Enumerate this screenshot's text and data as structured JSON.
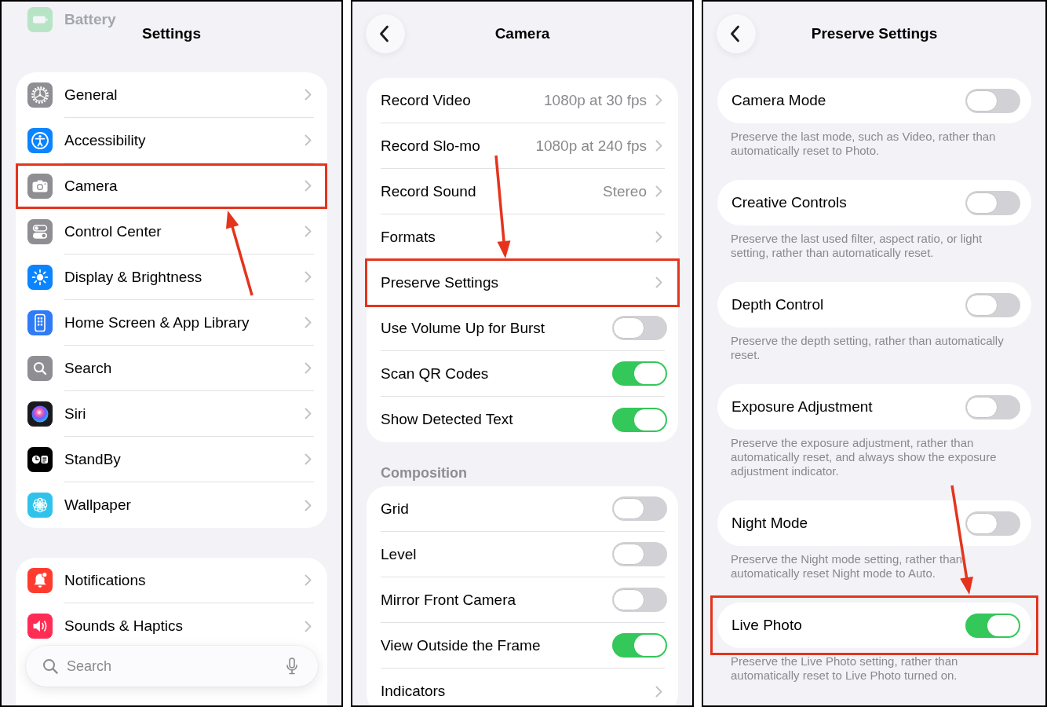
{
  "screens": [
    {
      "title": "Settings",
      "faded_item": {
        "label": "Battery"
      },
      "sections": [
        {
          "items": [
            {
              "kind": "app_link",
              "label": "General",
              "highlighted": false
            },
            {
              "kind": "app_link",
              "label": "Accessibility",
              "highlighted": false
            },
            {
              "kind": "app_link",
              "label": "Camera",
              "highlighted": true
            },
            {
              "kind": "app_link",
              "label": "Control Center",
              "highlighted": false
            },
            {
              "kind": "app_link",
              "label": "Display & Brightness",
              "highlighted": false
            },
            {
              "kind": "app_link",
              "label": "Home Screen & App Library",
              "highlighted": false
            },
            {
              "kind": "app_link",
              "label": "Search",
              "highlighted": false
            },
            {
              "kind": "app_link",
              "label": "Siri",
              "highlighted": false
            },
            {
              "kind": "app_link",
              "label": "StandBy",
              "highlighted": false
            },
            {
              "kind": "app_link",
              "label": "Wallpaper",
              "highlighted": false
            }
          ]
        },
        {
          "items": [
            {
              "kind": "app_link",
              "label": "Notifications",
              "highlighted": false
            },
            {
              "kind": "app_link",
              "label": "Sounds & Haptics",
              "highlighted": false
            }
          ]
        }
      ],
      "search": {
        "placeholder": "Search"
      }
    },
    {
      "title": "Camera",
      "back_button": true,
      "sections": [
        {
          "items": [
            {
              "kind": "link",
              "label": "Record Video",
              "value": "1080p at 30 fps",
              "highlighted": false
            },
            {
              "kind": "link",
              "label": "Record Slo-mo",
              "value": "1080p at 240 fps",
              "highlighted": false
            },
            {
              "kind": "link",
              "label": "Record Sound",
              "value": "Stereo",
              "highlighted": false
            },
            {
              "kind": "link",
              "label": "Formats",
              "highlighted": false
            },
            {
              "kind": "link",
              "label": "Preserve Settings",
              "highlighted": true
            },
            {
              "kind": "toggle",
              "label": "Use Volume Up for Burst",
              "on": false,
              "highlighted": false
            },
            {
              "kind": "toggle",
              "label": "Scan QR Codes",
              "on": true,
              "highlighted": false
            },
            {
              "kind": "toggle",
              "label": "Show Detected Text",
              "on": true,
              "highlighted": false
            }
          ]
        },
        {
          "header": "Composition",
          "items": [
            {
              "kind": "toggle",
              "label": "Grid",
              "on": false,
              "highlighted": false
            },
            {
              "kind": "toggle",
              "label": "Level",
              "on": false,
              "highlighted": false
            },
            {
              "kind": "toggle",
              "label": "Mirror Front Camera",
              "on": false,
              "highlighted": false
            },
            {
              "kind": "toggle",
              "label": "View Outside the Frame",
              "on": true,
              "highlighted": false
            },
            {
              "kind": "link",
              "label": "Indicators",
              "highlighted": false
            }
          ]
        }
      ]
    },
    {
      "title": "Preserve Settings",
      "back_button": true,
      "sections": [
        {
          "items": [
            {
              "kind": "toggle",
              "label": "Camera Mode",
              "on": false,
              "highlighted": false
            }
          ],
          "footer": "Preserve the last mode, such as Video, rather than automatically reset to Photo."
        },
        {
          "items": [
            {
              "kind": "toggle",
              "label": "Creative Controls",
              "on": false,
              "highlighted": false
            }
          ],
          "footer": "Preserve the last used filter, aspect ratio, or light setting, rather than automatically reset."
        },
        {
          "items": [
            {
              "kind": "toggle",
              "label": "Depth Control",
              "on": false,
              "highlighted": false
            }
          ],
          "footer": "Preserve the depth setting, rather than automatically reset."
        },
        {
          "items": [
            {
              "kind": "toggle",
              "label": "Exposure Adjustment",
              "on": false,
              "highlighted": false
            }
          ],
          "footer": "Preserve the exposure adjustment, rather than automatically reset, and always show the exposure adjustment indicator."
        },
        {
          "items": [
            {
              "kind": "toggle",
              "label": "Night Mode",
              "on": false,
              "highlighted": false
            }
          ],
          "footer": "Preserve the Night mode setting, rather than automatically reset Night mode to Auto."
        },
        {
          "items": [
            {
              "kind": "toggle",
              "label": "Live Photo",
              "on": true,
              "highlighted": true
            }
          ],
          "footer": "Preserve the Live Photo setting, rather than automatically reset to Live Photo turned on."
        }
      ]
    }
  ]
}
